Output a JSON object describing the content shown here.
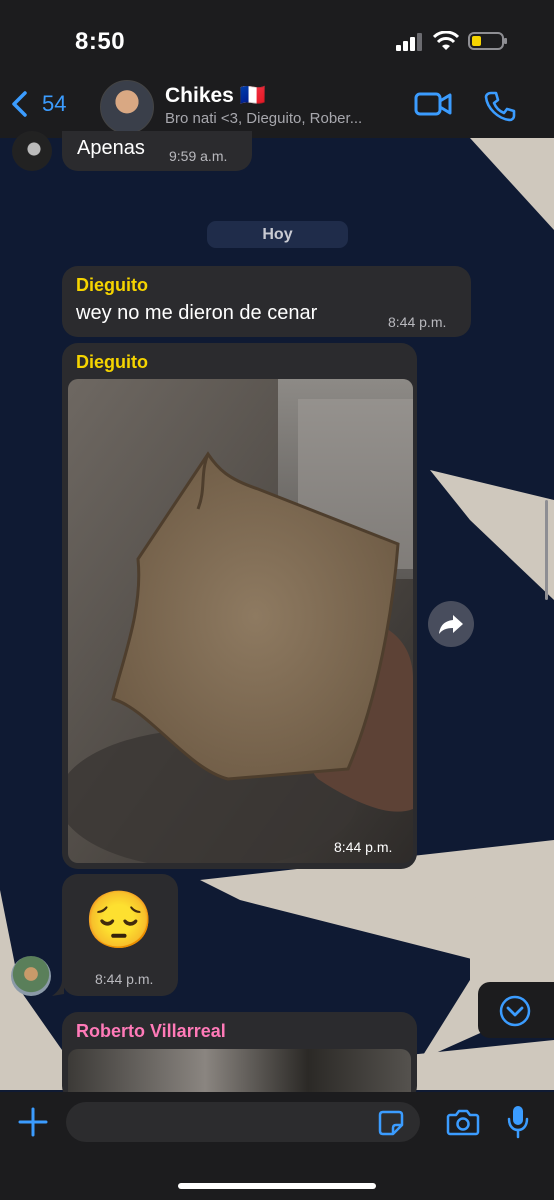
{
  "status": {
    "time": "8:50"
  },
  "header": {
    "back_count": "54",
    "title": "Chikes 🇫🇷",
    "subtitle": "Bro nati <3, Dieguito, Rober..."
  },
  "messages": {
    "prev": {
      "text": "Apenas",
      "time": "9:59 a.m."
    },
    "day_label": "Hoy",
    "m1": {
      "sender": "Dieguito",
      "text": "wey no me dieron de cenar",
      "time": "8:44 p.m."
    },
    "m2": {
      "sender": "Dieguito",
      "time": "8:44 p.m."
    },
    "m3": {
      "emoji": "😔",
      "time": "8:44 p.m."
    },
    "m4": {
      "sender": "Roberto Villarreal"
    }
  },
  "colors": {
    "accent": "#3b9cff",
    "dieguito": "#f5d400",
    "roberto": "#ff7ab8",
    "wallpaper_dark": "#0f1a33",
    "wallpaper_light": "#cfc8bd"
  }
}
